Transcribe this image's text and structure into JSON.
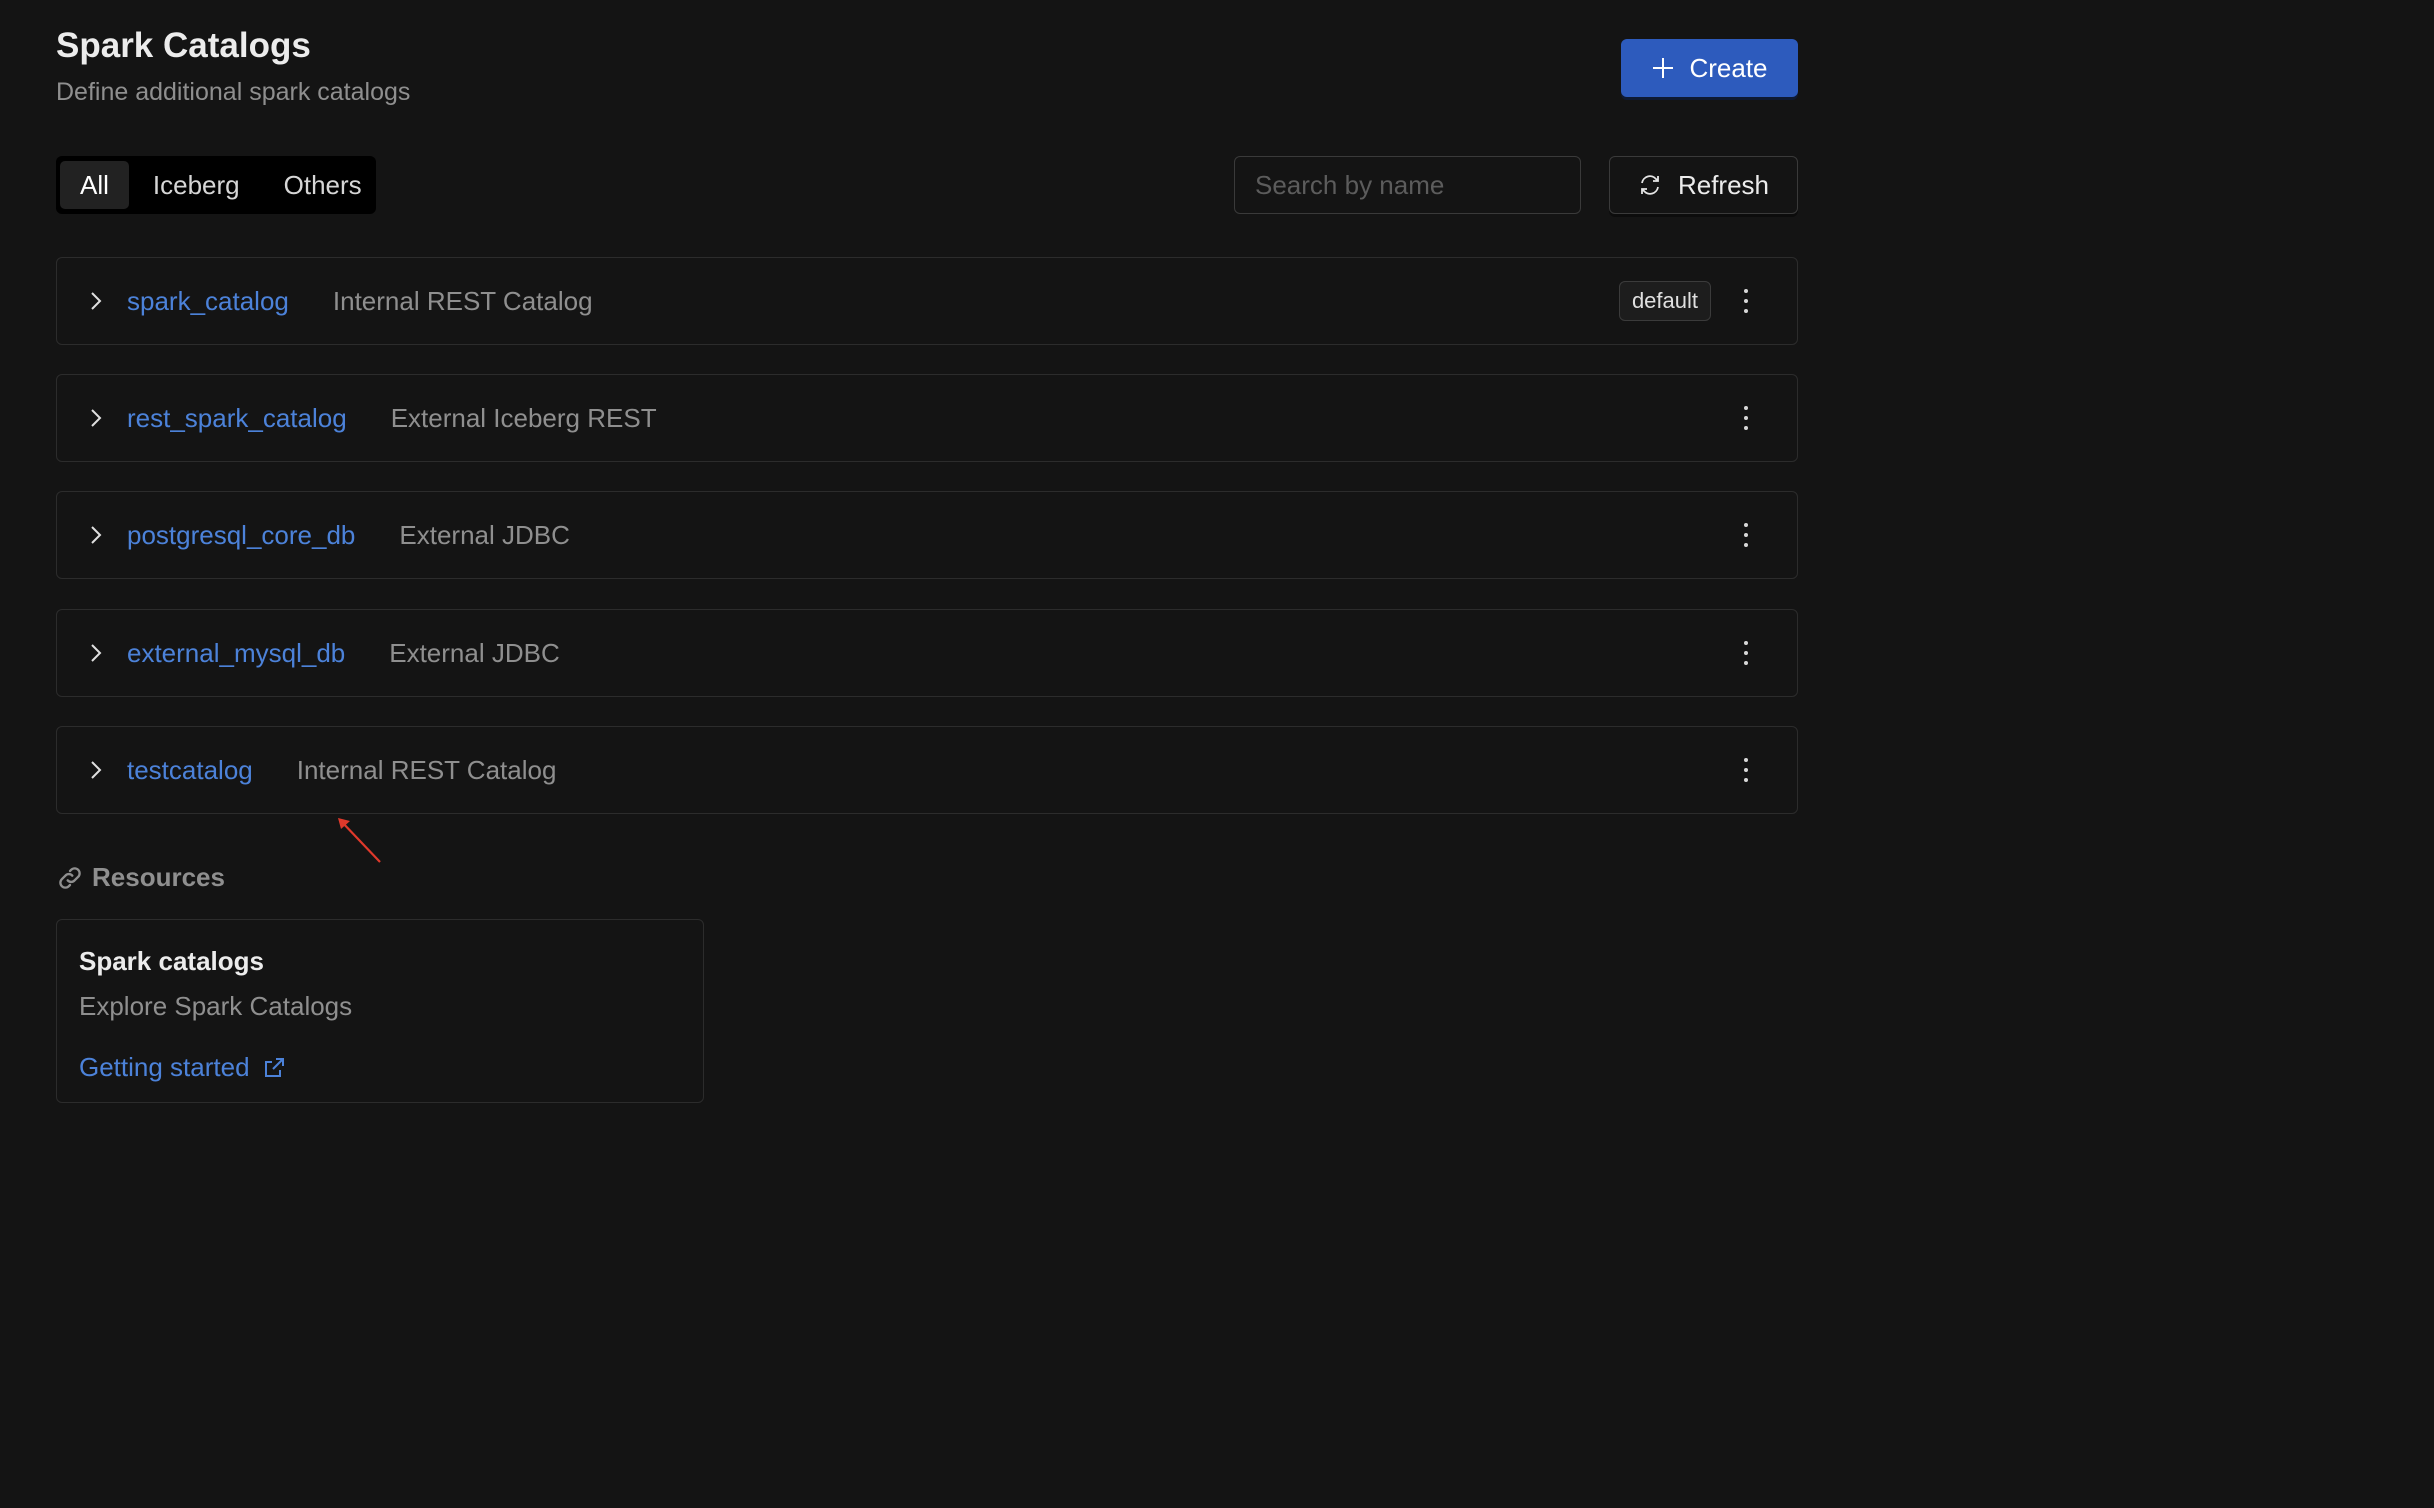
{
  "header": {
    "title": "Spark Catalogs",
    "subtitle": "Define additional spark catalogs",
    "create_label": "Create"
  },
  "filters": {
    "tabs": [
      {
        "label": "All",
        "active": true
      },
      {
        "label": "Iceberg",
        "active": false
      },
      {
        "label": "Others",
        "active": false
      }
    ],
    "search_placeholder": "Search by name",
    "search_value": "",
    "refresh_label": "Refresh"
  },
  "catalogs": [
    {
      "name": "spark_catalog",
      "type": "Internal REST Catalog",
      "badge": "default"
    },
    {
      "name": "rest_spark_catalog",
      "type": "External Iceberg REST",
      "badge": null
    },
    {
      "name": "postgresql_core_db",
      "type": "External JDBC",
      "badge": null
    },
    {
      "name": "external_mysql_db",
      "type": "External JDBC",
      "badge": null
    },
    {
      "name": "testcatalog",
      "type": "Internal REST Catalog",
      "badge": null
    }
  ],
  "resources": {
    "label": "Resources",
    "card": {
      "title": "Spark catalogs",
      "description": "Explore Spark Catalogs",
      "link_label": "Getting started"
    }
  },
  "colors": {
    "background": "#141414",
    "accent": "#2d5bbd",
    "link": "#4c82d9",
    "annotation": "#e0392b"
  }
}
